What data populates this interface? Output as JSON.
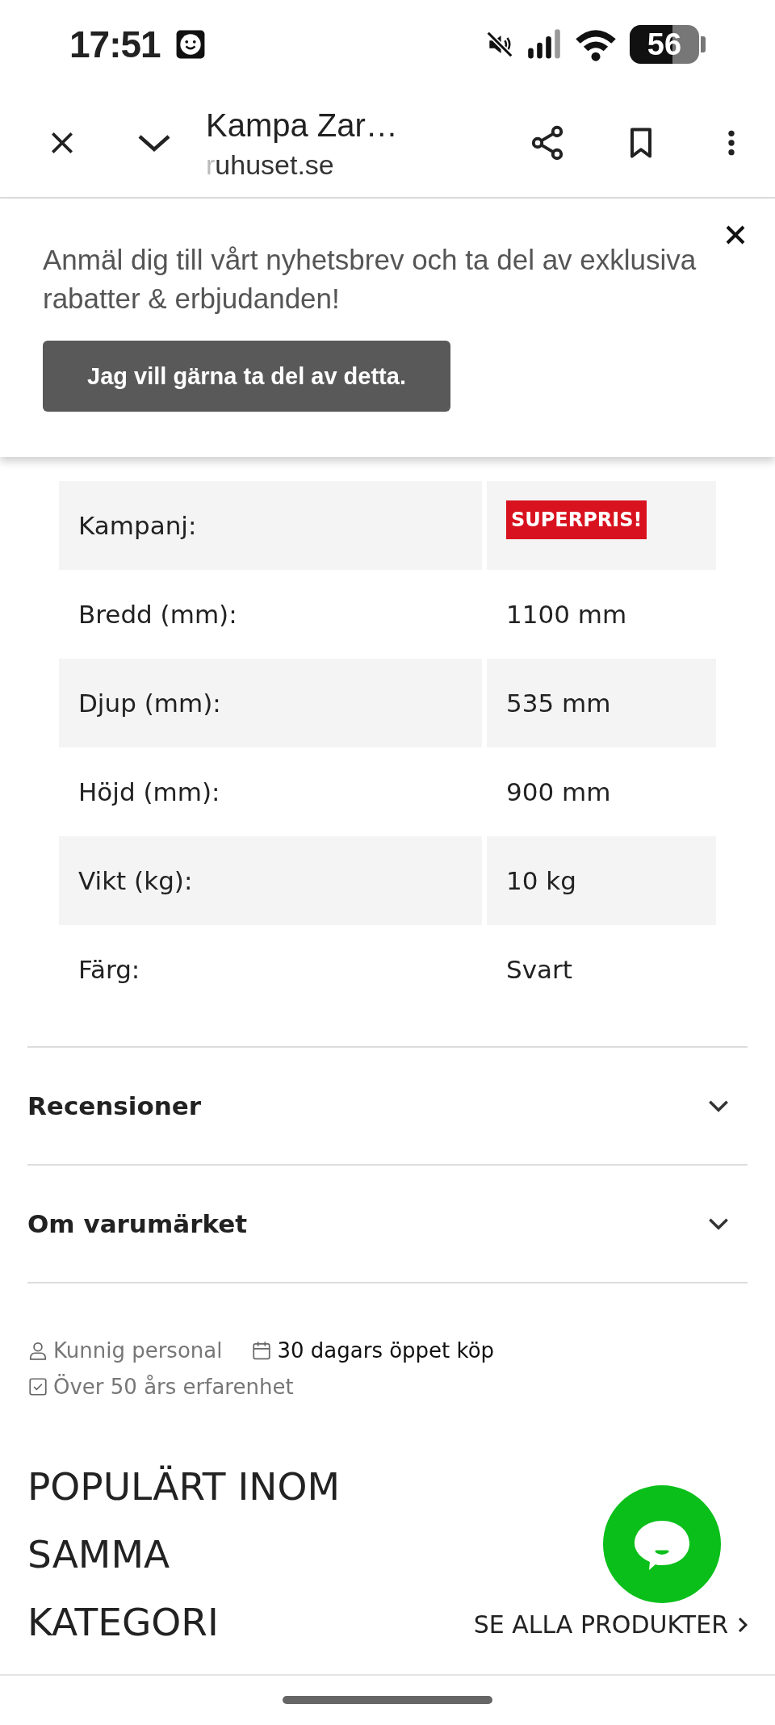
{
  "status_bar": {
    "time": "17:51",
    "battery": "56"
  },
  "browser_bar": {
    "title": "Kampa Zar…",
    "url": "ruhuset.se"
  },
  "newsletter": {
    "text": "Anmäl dig till vårt nyhetsbrev och ta del av exklusiva rabatter & erbjudanden!",
    "button": "Jag vill gärna ta del av detta."
  },
  "specs": [
    {
      "label": "Kampanj:",
      "value": "SUPERPRIS!",
      "kind": "badge"
    },
    {
      "label": "Bredd (mm):",
      "value": "1100 mm",
      "kind": "text"
    },
    {
      "label": "Djup (mm):",
      "value": "535 mm",
      "kind": "text"
    },
    {
      "label": "Höjd (mm):",
      "value": "900 mm",
      "kind": "text"
    },
    {
      "label": "Vikt (kg):",
      "value": "10 kg",
      "kind": "text"
    },
    {
      "label": "Färg:",
      "value": "Svart",
      "kind": "text"
    }
  ],
  "accordions": [
    {
      "title": "Recensioner",
      "expanded": false
    },
    {
      "title": "Om varumärket",
      "expanded": false
    }
  ],
  "features": [
    {
      "kind": "person",
      "text": "Kunnig personal",
      "highlighted": false
    },
    {
      "kind": "calendar",
      "text": "30 dagars öppet köp",
      "highlighted": true
    },
    {
      "kind": "check",
      "text": "Över 50 års erfarenhet",
      "highlighted": false
    }
  ],
  "section": {
    "heading": "POPULÄRT INOM SAMMA KATEGORI",
    "link": "SE ALLA PRODUKTER"
  }
}
